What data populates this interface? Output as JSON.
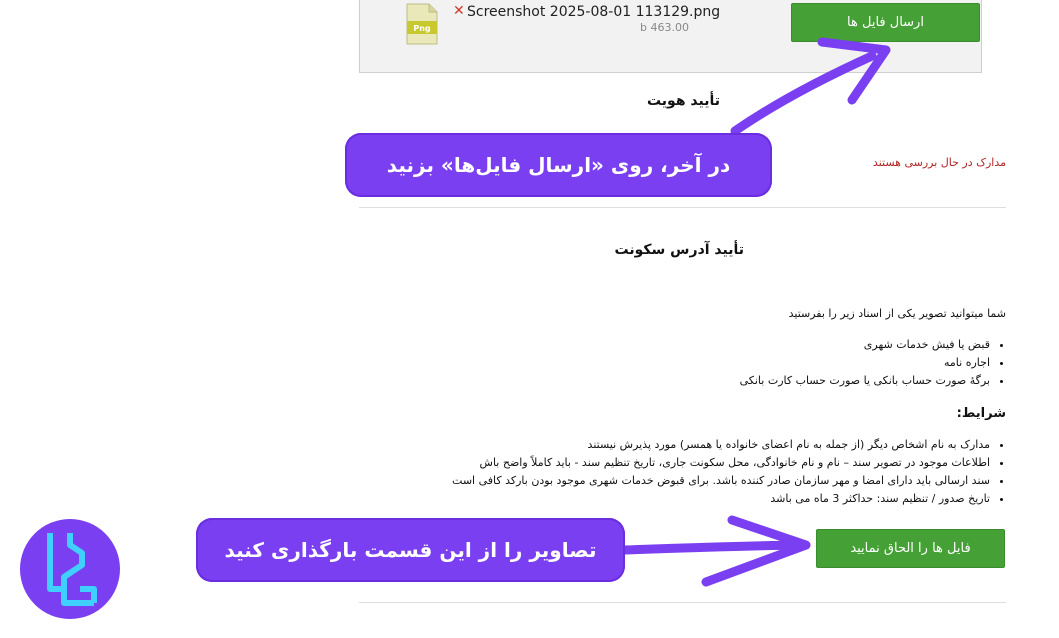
{
  "upload": {
    "file_name": "Screenshot 2025-08-01 113129.png",
    "file_size": "b 463.00",
    "file_type_badge": "Png",
    "remove_icon": "close-icon",
    "send_button": "ارسال فایل ها"
  },
  "identity": {
    "title": "تأیید هویت",
    "status": "مدارک در حال بررسی هستند"
  },
  "address": {
    "title": "تأیید آدرس سکونت",
    "intro": "شما میتوانید تصویر یکی از اسناد زیر را بفرستید",
    "documents": [
      "قبض یا فیش خدمات شهری",
      "اجاره نامه",
      "برگهٔ صورت حساب بانکی یا صورت حساب کارت بانکی"
    ],
    "conditions_title": "شرایط:",
    "conditions": [
      "مدارک به نام اشخاص دیگر (از جمله به نام اعضای خانواده یا همسر) مورد پذیرش نیستند",
      "اطلاعات موجود در تصویر سند – نام و نام خانوادگی، محل سکونت جاری، تاریخ تنظیم سند - باید کاملاً واضح باش",
      "سند ارسالی باید دارای امضا و مهر سازمان صادر کننده باشد. برای قبوض خدمات شهری موجود بودن بارکد کافی است",
      "تاریخ صدور / تنظیم سند: حداکثر 3 ماه می باشد"
    ],
    "attach_button": "فایل ها را الحاق نمایید"
  },
  "callouts": {
    "send_hint": "در آخر، روی «ارسال فایل‌ها» بزنید",
    "upload_hint": "تصاویر را از این قسمت بارگذاری کنید"
  },
  "colors": {
    "callout_purple": "#7b3ff2",
    "button_green": "#45a135",
    "status_red": "#b22222"
  }
}
